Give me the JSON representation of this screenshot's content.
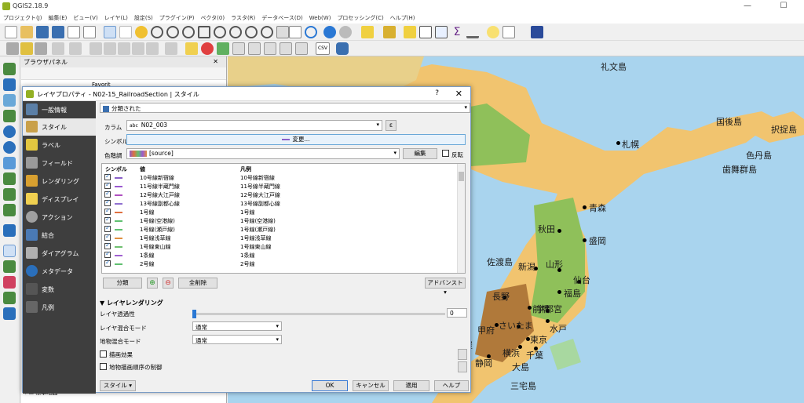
{
  "window": {
    "title": "QGIS2.18.9"
  },
  "menu": [
    "プロジェクト(J)",
    "編集(E)",
    "ビュー(V)",
    "レイヤ(L)",
    "設定(S)",
    "プラグイン(P)",
    "ベクタ(0)",
    "ラスタ(R)",
    "データベース(D)",
    "Web(W)",
    "プロセッシング(C)",
    "ヘルプ(H)"
  ],
  "browser": {
    "title": "ブラウザパネル",
    "item": "Favorit"
  },
  "dialog": {
    "title": "レイヤプロパティ - N02-15_RailroadSection | スタイル",
    "help": "?",
    "close": "✕",
    "renderer": "分類された",
    "column_label": "カラム",
    "column_value": "N02_003",
    "column_prefix": "abc",
    "symbol_label": "シンボル",
    "symbol_value": "変更...",
    "ramp_label": "色階調",
    "ramp_value": "[source]",
    "edit_button": "編集",
    "invert_label": "反転",
    "col_headers": [
      "シンボル",
      "値",
      "凡例"
    ],
    "classify_button": "分類",
    "delete_all_button": "全削除",
    "advanced_button": "アドバンスト",
    "layer_rendering": "レイヤレンダリング",
    "transparency_label": "レイヤ透過性",
    "transparency_value": "0",
    "blend_layer_label": "レイヤ混合モード",
    "blend_layer_value": "通常",
    "blend_feature_label": "地物混合モード",
    "blend_feature_value": "通常",
    "draw_effects": "描画効果",
    "control_order": "地物描画順序の制御",
    "style_button": "スタイル",
    "ok": "OK",
    "cancel": "キャンセル",
    "apply": "適用",
    "help_button": "ヘルプ"
  },
  "nav": [
    {
      "label": "一般情報",
      "color": "#5b7fa6"
    },
    {
      "label": "スタイル",
      "color": "#c9a04a"
    },
    {
      "label": "ラベル",
      "color": "#e2c640"
    },
    {
      "label": "フィールド",
      "color": "#9a9a9a"
    },
    {
      "label": "レンダリング",
      "color": "#d8a030"
    },
    {
      "label": "ディスプレイ",
      "color": "#f0d050"
    },
    {
      "label": "アクション",
      "color": "#a0a0a0"
    },
    {
      "label": "結合",
      "color": "#4a7ab5"
    },
    {
      "label": "ダイアグラム",
      "color": "#b0b0b0"
    },
    {
      "label": "メタデータ",
      "color": "#2a6fbb"
    },
    {
      "label": "変数",
      "color": "#555555"
    },
    {
      "label": "凡例",
      "color": "#666666"
    }
  ],
  "rows": [
    {
      "value": "10号線新宿線",
      "legend": "10号線新宿線",
      "color": "#8a60c8"
    },
    {
      "value": "11号線半蔵門線",
      "legend": "11号線半蔵門線",
      "color": "#9b59d0"
    },
    {
      "value": "12号線大江戸線",
      "legend": "12号線大江戸線",
      "color": "#b050c0"
    },
    {
      "value": "13号線副都心線",
      "legend": "13号線副都心線",
      "color": "#9070d0"
    },
    {
      "value": "1号線",
      "legend": "1号線",
      "color": "#e07040"
    },
    {
      "value": "1号線(空港線)",
      "legend": "1号線(空港線)",
      "color": "#60c070"
    },
    {
      "value": "1号線(瀬戸線)",
      "legend": "1号線(瀬戸線)",
      "color": "#60c070"
    },
    {
      "value": "1号線浅草線",
      "legend": "1号線浅草線",
      "color": "#e09040"
    },
    {
      "value": "1号線東山線",
      "legend": "1号線東山線",
      "color": "#70c070"
    },
    {
      "value": "1条線",
      "legend": "1条線",
      "color": "#a060d0"
    },
    {
      "value": "2号線",
      "legend": "2号線",
      "color": "#60c070"
    }
  ],
  "map_labels": [
    "礼文島",
    "国後島",
    "択捉島",
    "札幌",
    "色丹島",
    "歯舞群島",
    "青森",
    "秋田",
    "盛岡",
    "佐渡島",
    "新潟",
    "山形",
    "仙台",
    "長野",
    "前橋",
    "宇都宮",
    "福島",
    "甲府",
    "さいたま",
    "水戸",
    "古屋",
    "横浜",
    "東京",
    "千葉",
    "静岡",
    "大島",
    "三宅島"
  ]
}
